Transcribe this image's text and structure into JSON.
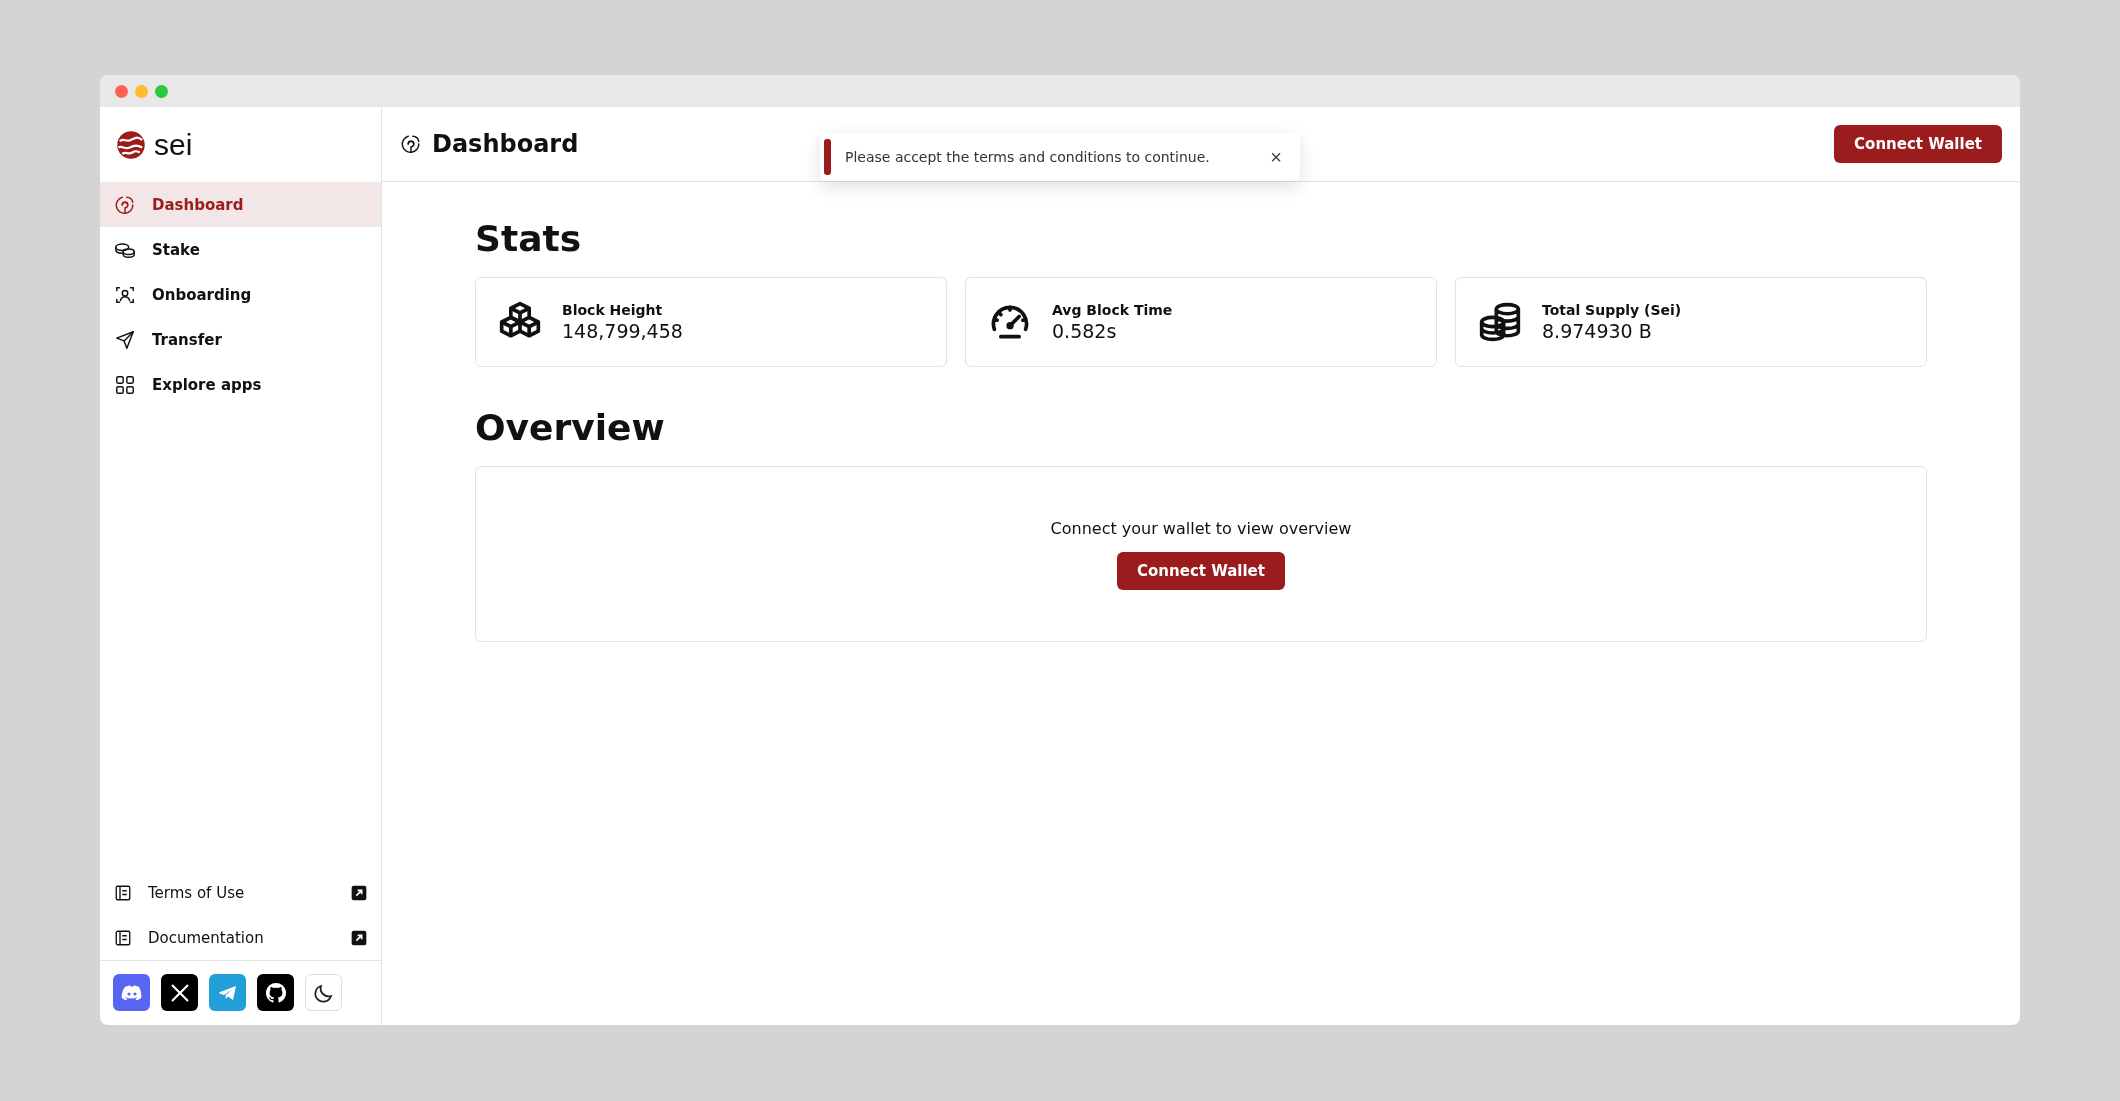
{
  "sidebar": {
    "logo": "sei",
    "items": [
      {
        "label": "Dashboard",
        "selected": true
      },
      {
        "label": "Stake",
        "selected": false
      },
      {
        "label": "Onboarding",
        "selected": false
      },
      {
        "label": "Transfer",
        "selected": false
      },
      {
        "label": "Explore apps",
        "selected": false
      }
    ],
    "footer_links": [
      {
        "label": "Terms of Use"
      },
      {
        "label": "Documentation"
      }
    ]
  },
  "header": {
    "title": "Dashboard",
    "button": "Connect Wallet"
  },
  "toast": {
    "message": "Please accept the terms and conditions to continue.",
    "close": "×"
  },
  "stats": {
    "title": "Stats",
    "cards": [
      {
        "label": "Block Height",
        "value": "148,799,458"
      },
      {
        "label": "Avg Block Time",
        "value": "0.582s"
      },
      {
        "label": "Total Supply (Sei)",
        "value": "8.974930 B"
      }
    ]
  },
  "overview": {
    "title": "Overview",
    "message": "Connect your wallet to view overview",
    "button": "Connect Wallet"
  }
}
